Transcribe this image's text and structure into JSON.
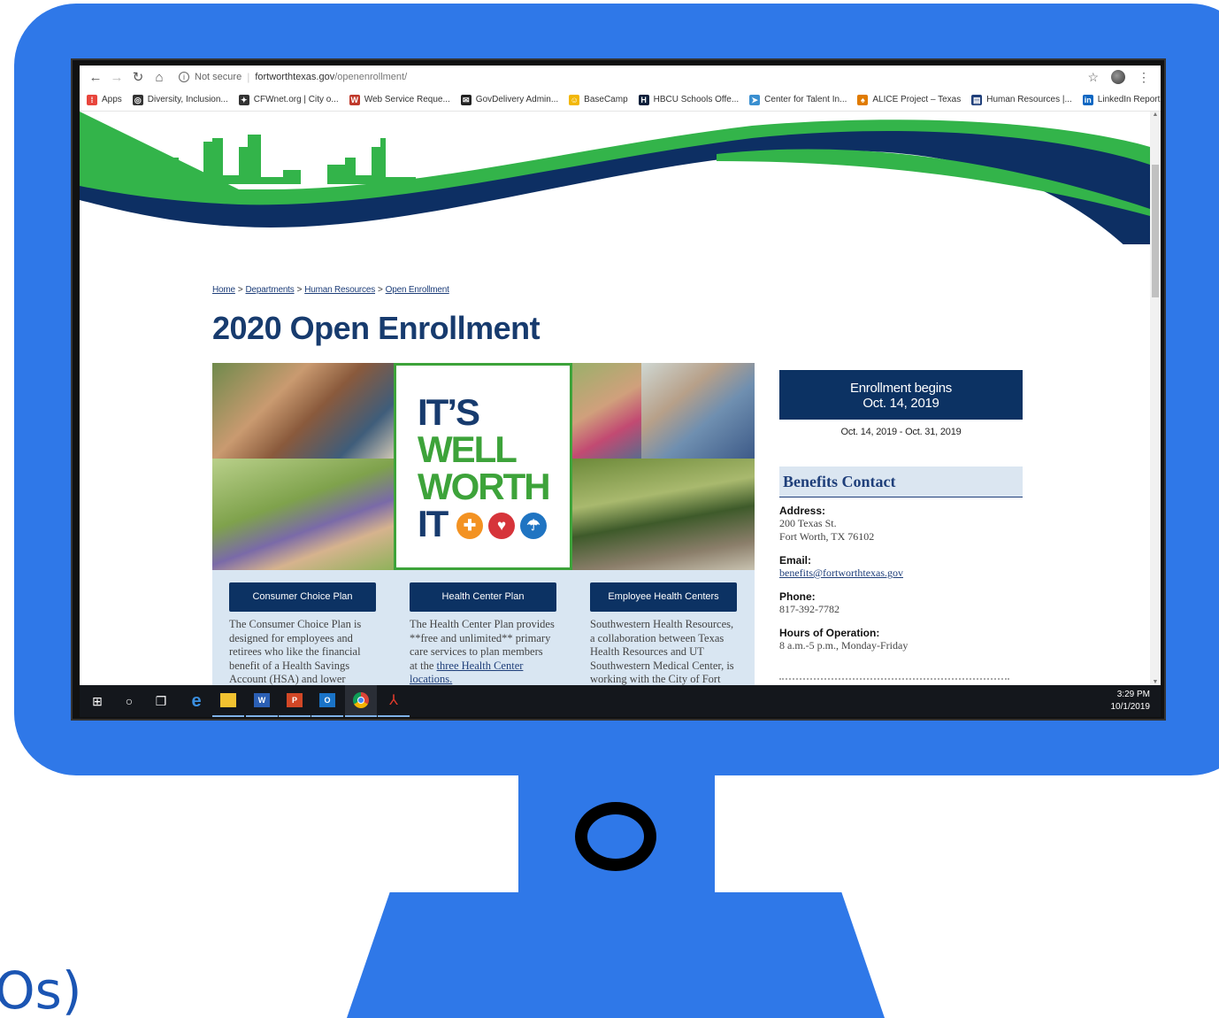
{
  "browser": {
    "not_secure": "Not secure",
    "url_domain": "fortworthtexas.gov",
    "url_path": "/openenrollment/"
  },
  "bookmarks": [
    {
      "label": "Apps",
      "icon": "apps-grid-icon",
      "color": "#e8453c"
    },
    {
      "label": "Diversity, Inclusion...",
      "icon": "globe-icon",
      "color": "#333333"
    },
    {
      "label": "CFWnet.org | City o...",
      "icon": "cfw-icon",
      "color": "#333333"
    },
    {
      "label": "Web Service Reque...",
      "icon": "web-service-icon",
      "color": "#c0392b"
    },
    {
      "label": "GovDelivery Admin...",
      "icon": "govdelivery-icon",
      "color": "#222222"
    },
    {
      "label": "BaseCamp",
      "icon": "basecamp-icon",
      "color": "#f2b705"
    },
    {
      "label": "HBCU Schools Offe...",
      "icon": "hbcu-icon",
      "color": "#0b1f3a"
    },
    {
      "label": "Center for Talent In...",
      "icon": "talent-icon",
      "color": "#3a8fd0"
    },
    {
      "label": "ALICE Project – Texas",
      "icon": "alice-icon",
      "color": "#e07b00"
    },
    {
      "label": "Human Resources |...",
      "icon": "hr-icon",
      "color": "#1f3f7a"
    },
    {
      "label": "LinkedIn Report: Th...",
      "icon": "linkedin-icon",
      "color": "#0a66c2"
    }
  ],
  "breadcrumb": {
    "home": "Home",
    "departments": "Departments",
    "human_resources": "Human Resources",
    "open_enrollment": "Open Enrollment",
    "separator": ">"
  },
  "page_title": "2020 Open Enrollment",
  "promo": {
    "line1": "IT’S",
    "line2": "WELL",
    "line3": "WORTH",
    "line4": "IT"
  },
  "plans": [
    {
      "button": "Consumer Choice Plan",
      "text_lines": [
        "The Consumer Choice Plan is",
        "designed for employees and",
        "retirees who like the financial",
        "benefit of a Health Savings",
        "Account (HSA) and lower"
      ],
      "link": ""
    },
    {
      "button": "Health Center Plan",
      "text_lines": [
        "The Health Center Plan provides",
        "**free and unlimited** primary",
        "care services to plan members",
        "at the"
      ],
      "link": "three Health Center",
      "after_link": "locations."
    },
    {
      "button": "Employee Health Centers",
      "text_lines": [
        "Southwestern Health Resources,",
        "a collaboration between Texas",
        "Health Resources and UT",
        "Southwestern Medical Center, is",
        "working with the City of Fort"
      ],
      "link": ""
    }
  ],
  "sidebar": {
    "enroll_line1": "Enrollment begins",
    "enroll_line2": "Oct. 14, 2019",
    "enroll_dates": "Oct. 14, 2019 - Oct. 31, 2019",
    "contact_title": "Benefits Contact",
    "address_label": "Address:",
    "address_line1": "200 Texas St.",
    "address_line2": "Fort Worth, TX 76102",
    "email_label": "Email:",
    "email": "benefits@fortworthtexas.gov",
    "phone_label": "Phone:",
    "phone": "817-392-7782",
    "hours_label": "Hours of Operation:",
    "hours": "8 a.m.-5 p.m., Monday-Friday"
  },
  "taskbar": {
    "time": "3:29 PM",
    "date": "10/1/2019",
    "apps": [
      "start-icon",
      "cortana-icon",
      "task-view-icon",
      "edge-icon",
      "file-explorer-icon",
      "word-icon",
      "powerpoint-icon",
      "outlook-icon",
      "chrome-icon",
      "acrobat-icon"
    ]
  },
  "slide_text": "Os)",
  "colors": {
    "monitor": "#2f78e8",
    "navy": "#0c3263",
    "green": "#3da33a",
    "banner_green": "#33b44a",
    "banner_blue": "#0d2f63",
    "plan_bg": "#d9e6f2"
  }
}
